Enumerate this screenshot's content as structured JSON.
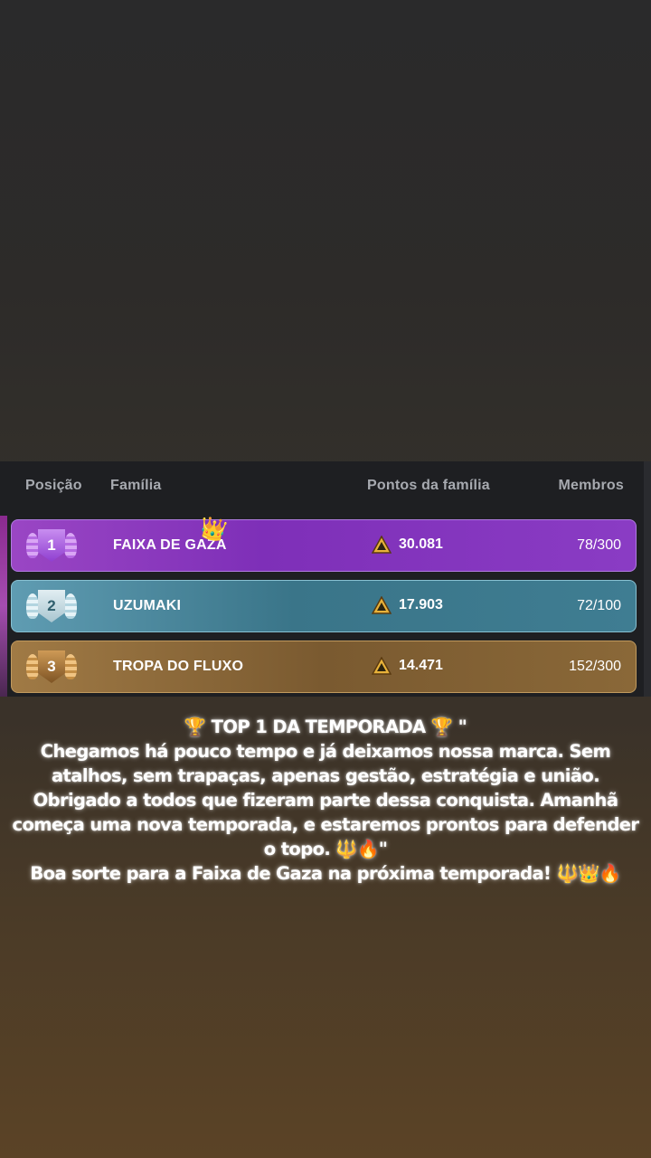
{
  "leaderboard": {
    "headers": {
      "position": "Posição",
      "family": "Família",
      "points": "Pontos da família",
      "members": "Membros"
    },
    "rows": [
      {
        "rank": "1",
        "name": "FAIXA DE GAZA",
        "crown": "👑",
        "points": "30.081",
        "members": "78/300"
      },
      {
        "rank": "2",
        "name": "UZUMAKI",
        "points": "17.903",
        "members": "72/100"
      },
      {
        "rank": "3",
        "name": "TROPA DO FLUXO",
        "points": "14.471",
        "members": "152/300"
      }
    ]
  },
  "caption": {
    "lines": [
      "🏆 TOP 1 DA TEMPORADA 🏆 \"",
      "Chegamos há pouco tempo e já deixamos nossa marca. Sem",
      "atalhos, sem trapaças, apenas gestão, estratégia e união.",
      "Obrigado a todos que fizeram parte dessa conquista. Amanhã",
      "começa uma nova temporada, e estaremos prontos para defender",
      "o topo. 🔱🔥\"",
      "Boa sorte para a Faixa de Gaza na próxima temporada! 🔱👑🔥"
    ]
  }
}
